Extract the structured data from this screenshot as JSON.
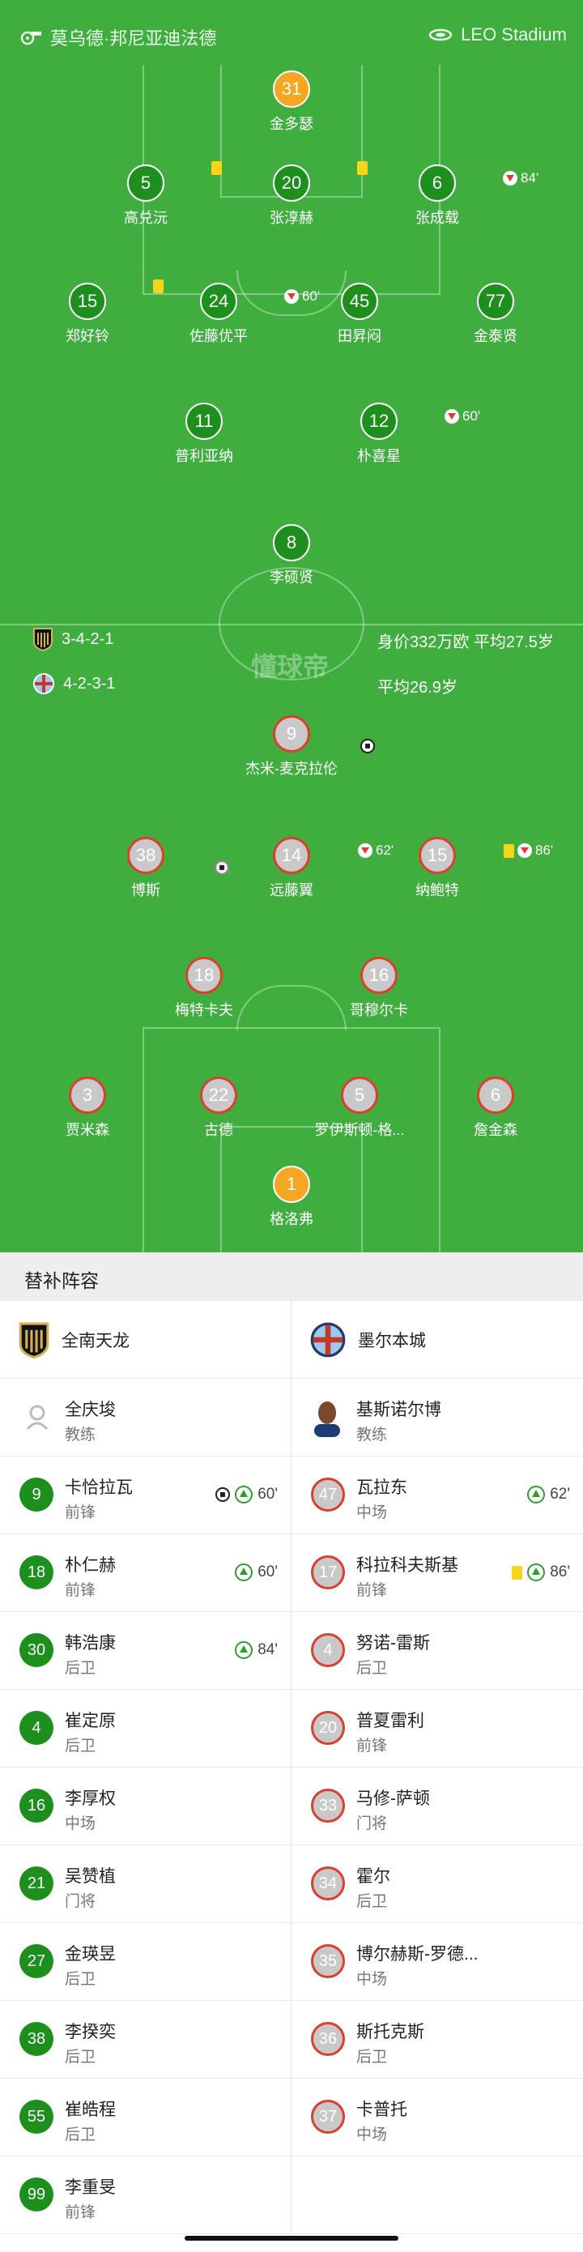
{
  "header": {
    "home_team": "莫乌德·邦尼亚迪法德",
    "venue": "LEO Stadium"
  },
  "home_formation": "3-4-2-1",
  "home_value": "身价332万欧 平均27.5岁",
  "away_formation": "4-2-3-1",
  "away_age": "平均26.9岁",
  "watermark": "懂球帝",
  "home_lineup": [
    {
      "num": "31",
      "name": "金多瑟",
      "role": "keeper"
    },
    {
      "num": "5",
      "name": "高兑沅",
      "ev": "yc"
    },
    {
      "num": "20",
      "name": "张淳赫",
      "ev": "yc"
    },
    {
      "num": "6",
      "name": "张成载",
      "ev": "out",
      "min": "84'"
    },
    {
      "num": "15",
      "name": "郑好铃",
      "ev": "yc"
    },
    {
      "num": "24",
      "name": "佐藤优平",
      "ev": "out",
      "min": "60'"
    },
    {
      "num": "45",
      "name": "田昇闷"
    },
    {
      "num": "77",
      "name": "金泰贤"
    },
    {
      "num": "11",
      "name": "普利亚纳"
    },
    {
      "num": "12",
      "name": "朴喜星",
      "ev": "out",
      "min": "60'"
    },
    {
      "num": "8",
      "name": "李硕贤"
    }
  ],
  "away_lineup": [
    {
      "num": "9",
      "name": "杰米-麦克拉伦",
      "ev": "goal"
    },
    {
      "num": "38",
      "name": "博斯",
      "ev": "assist"
    },
    {
      "num": "14",
      "name": "远藤翼",
      "ev": "out",
      "min": "62'"
    },
    {
      "num": "15",
      "name": "纳鲍特",
      "ev": "ycout",
      "min": "86'"
    },
    {
      "num": "18",
      "name": "梅特卡夫"
    },
    {
      "num": "16",
      "name": "哥穆尔卡"
    },
    {
      "num": "3",
      "name": "贾米森"
    },
    {
      "num": "22",
      "name": "古德"
    },
    {
      "num": "5",
      "name": "罗伊斯顿-格..."
    },
    {
      "num": "6",
      "name": "詹金森"
    },
    {
      "num": "1",
      "name": "格洛弗",
      "role": "keeper"
    }
  ],
  "subs_title": "替补阵容",
  "home_team_name": "全南天龙",
  "away_team_name": "墨尔本城",
  "home_coach": {
    "name": "全庆埈",
    "role": "教练"
  },
  "away_coach": {
    "name": "基斯诺尔博",
    "role": "教练"
  },
  "home_subs": [
    {
      "num": "9",
      "name": "卡恰拉瓦",
      "pos": "前锋",
      "ev": "goalin",
      "min": "60'"
    },
    {
      "num": "18",
      "name": "朴仁赫",
      "pos": "前锋",
      "ev": "in",
      "min": "60'"
    },
    {
      "num": "30",
      "name": "韩浩康",
      "pos": "后卫",
      "ev": "in",
      "min": "84'"
    },
    {
      "num": "4",
      "name": "崔定原",
      "pos": "后卫"
    },
    {
      "num": "16",
      "name": "李厚权",
      "pos": "中场"
    },
    {
      "num": "21",
      "name": "吴赞植",
      "pos": "门将"
    },
    {
      "num": "27",
      "name": "金瑛昱",
      "pos": "后卫"
    },
    {
      "num": "38",
      "name": "李揆奕",
      "pos": "后卫"
    },
    {
      "num": "55",
      "name": "崔皓程",
      "pos": "后卫"
    },
    {
      "num": "99",
      "name": "李重旻",
      "pos": "前锋"
    }
  ],
  "away_subs": [
    {
      "num": "47",
      "name": "瓦拉东",
      "pos": "中场",
      "ev": "in",
      "min": "62'"
    },
    {
      "num": "17",
      "name": "科拉科夫斯基",
      "pos": "前锋",
      "ev": "ycin",
      "min": "86'"
    },
    {
      "num": "4",
      "name": "努诺-雷斯",
      "pos": "后卫"
    },
    {
      "num": "20",
      "name": "普夏雷利",
      "pos": "前锋"
    },
    {
      "num": "33",
      "name": "马修-萨顿",
      "pos": "门将"
    },
    {
      "num": "34",
      "name": "霍尔",
      "pos": "后卫"
    },
    {
      "num": "35",
      "name": "博尔赫斯-罗德...",
      "pos": "中场"
    },
    {
      "num": "36",
      "name": "斯托克斯",
      "pos": "后卫"
    },
    {
      "num": "37",
      "name": "卡普托",
      "pos": "中场"
    }
  ]
}
